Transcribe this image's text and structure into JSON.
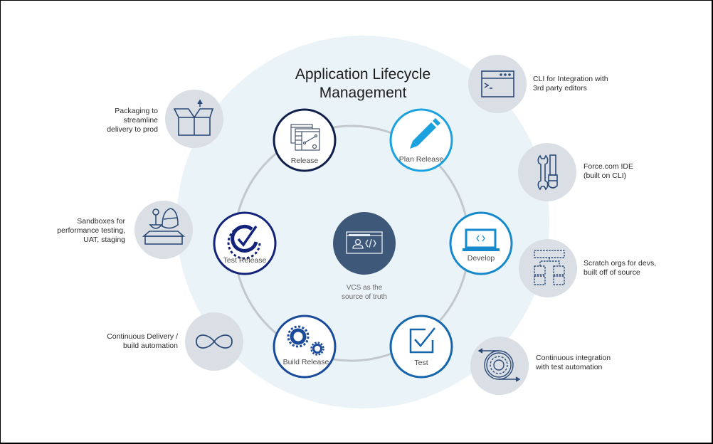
{
  "title_line1": "Application Lifecycle",
  "title_line2": "Management",
  "center": {
    "icon": "vcs-code-window-icon",
    "label_line1": "VCS as the",
    "label_line2": "source of truth",
    "color": "#3d5878"
  },
  "cycle_nodes": [
    {
      "id": "release",
      "label": "Release",
      "icon": "release-dashboard-icon",
      "color": "#0f1f4a"
    },
    {
      "id": "plan-release",
      "label": "Plan Release",
      "icon": "pencil-icon",
      "color": "#1ba1dd"
    },
    {
      "id": "develop",
      "label": "Develop",
      "icon": "laptop-code-icon",
      "color": "#1589cc"
    },
    {
      "id": "test",
      "label": "Test",
      "icon": "checkbox-icon",
      "color": "#1566ad"
    },
    {
      "id": "build-release",
      "label": "Build Release",
      "icon": "gears-icon",
      "color": "#1a4a9a"
    },
    {
      "id": "test-release",
      "label": "Test Release",
      "icon": "gear-check-icon",
      "color": "#13237a"
    }
  ],
  "left_items": [
    {
      "id": "packaging",
      "lines": [
        "Packaging to",
        "streamline",
        "delivery to prod"
      ],
      "icon": "open-box-icon"
    },
    {
      "id": "sandboxes",
      "lines": [
        "Sandboxes for",
        "performance testing,",
        "UAT, staging"
      ],
      "icon": "sandbox-icon"
    },
    {
      "id": "continuous-delivery",
      "lines": [
        "Continuous Delivery /",
        "build automation"
      ],
      "icon": "infinity-icon"
    }
  ],
  "right_items": [
    {
      "id": "cli",
      "lines": [
        "CLI for Integration with",
        "3rd party editors"
      ],
      "icon": "terminal-window-icon"
    },
    {
      "id": "ide",
      "lines": [
        "Force.com IDE",
        "(built on CLI)"
      ],
      "icon": "wrench-screwdriver-icon"
    },
    {
      "id": "scratch-orgs",
      "lines": [
        "Scratch orgs for devs,",
        "built off of source"
      ],
      "icon": "org-chart-icon"
    },
    {
      "id": "continuous-integration",
      "lines": [
        "Continuous integration",
        "with test automation"
      ],
      "icon": "gear-cycle-icon"
    }
  ],
  "colors": {
    "background_circle": "#eaf3f7",
    "ring": "#c3c8cc",
    "side_circle": "#d9dfe4",
    "side_icon": "#2d4b78"
  }
}
